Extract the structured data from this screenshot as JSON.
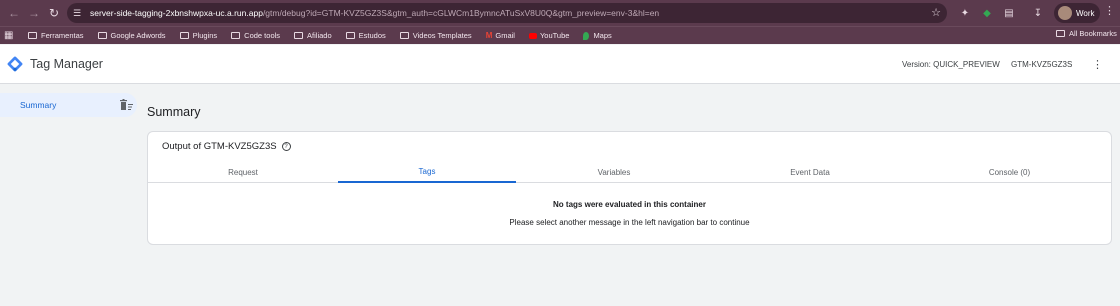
{
  "browser": {
    "url_host": "server-side-tagging-2xbnshwpxa-uc.a.run.app",
    "url_path": "/gtm/debug?id=GTM-KVZ5GZ3S&gtm_auth=cGLWCm1BymncATuSxV8U0Q&gtm_preview=env-3&hl=en",
    "profile_label": "Work",
    "bookmarks": [
      "Ferramentas",
      "Google Adwords",
      "Plugins",
      "Code tools",
      "Afiliado",
      "Estudos",
      "Videos Templates",
      "Gmail",
      "YouTube",
      "Maps"
    ],
    "all_bookmarks": "All Bookmarks"
  },
  "app": {
    "title": "Tag Manager",
    "version": "Version: QUICK_PREVIEW",
    "container_id": "GTM-KVZ5GZ3S"
  },
  "sidebar": {
    "items": [
      {
        "label": "Summary"
      }
    ]
  },
  "main": {
    "page_title": "Summary",
    "card_title": "Output of GTM-KVZ5GZ3S",
    "tabs": [
      {
        "label": "Request"
      },
      {
        "label": "Tags"
      },
      {
        "label": "Variables"
      },
      {
        "label": "Event Data"
      },
      {
        "label": "Console (0)"
      }
    ],
    "active_tab": "Tags",
    "empty_title": "No tags were evaluated in this container",
    "empty_subtitle": "Please select another message in the left navigation bar to continue"
  },
  "colors": {
    "accent": "#1967d2",
    "chrome": "#5b3a4d",
    "sidebar_active_bg": "#e8f0fe"
  }
}
